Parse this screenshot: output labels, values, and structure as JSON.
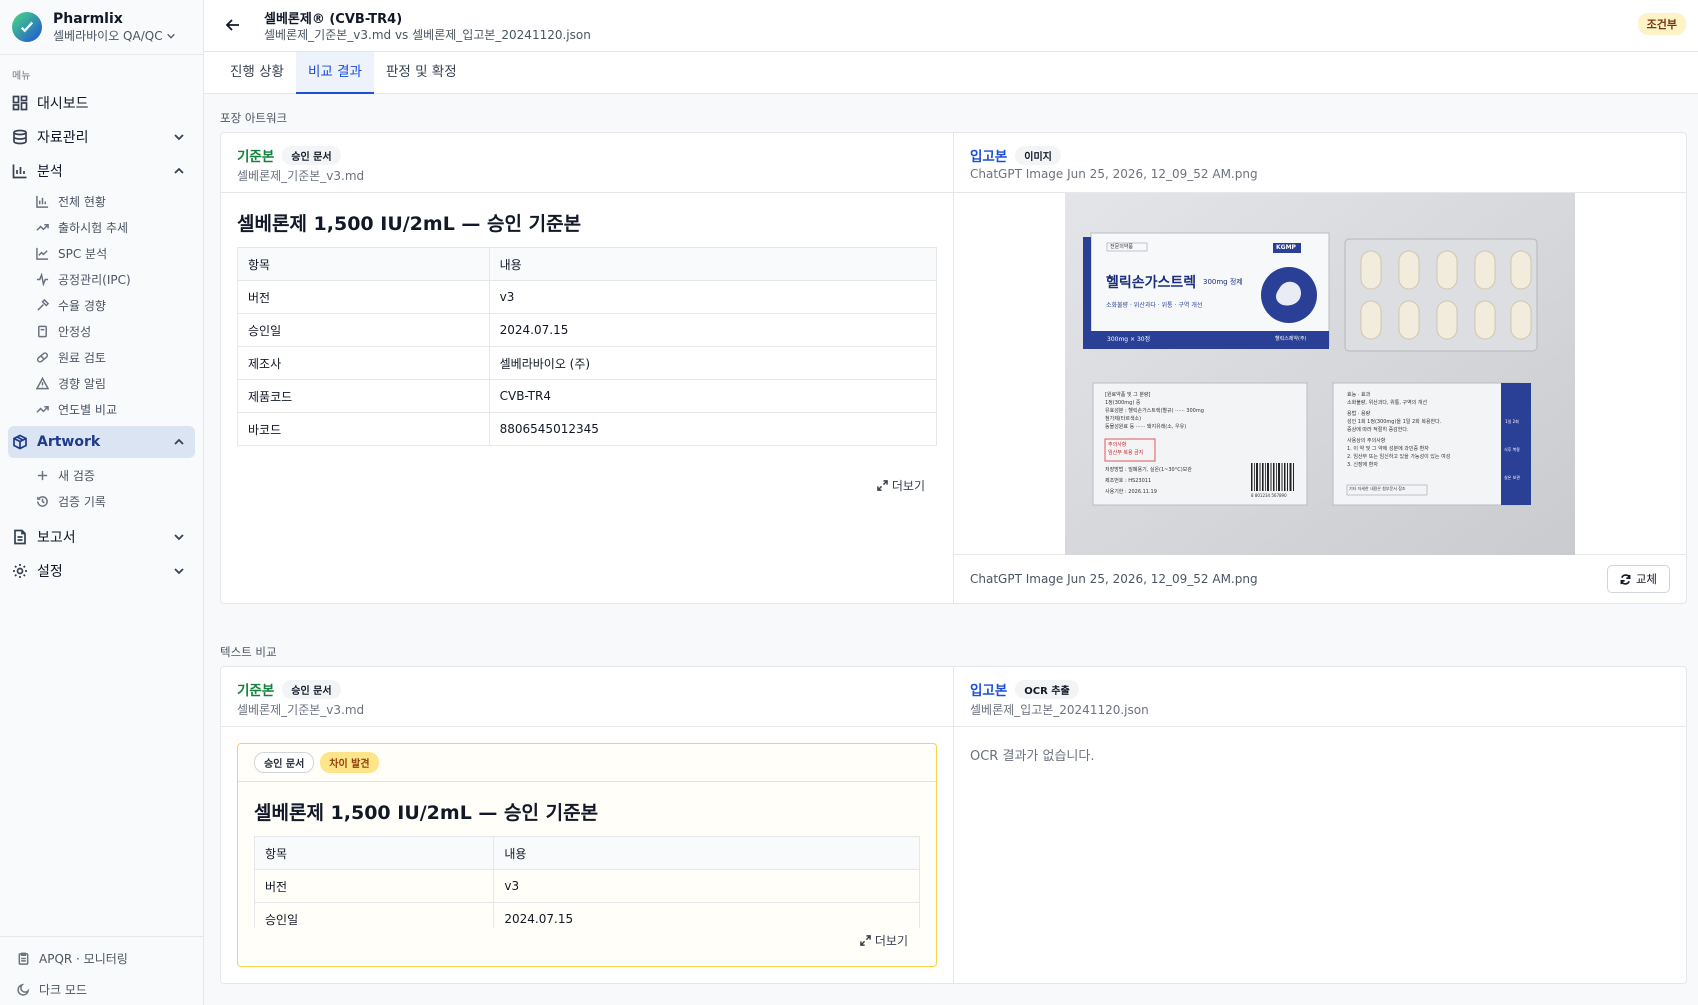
{
  "app": {
    "name": "Pharmlix",
    "org": "셀베라바이오 QA/QC"
  },
  "sidebar": {
    "menu_label": "메뉴",
    "items": [
      {
        "label": "대시보드"
      },
      {
        "label": "자료관리"
      },
      {
        "label": "분석"
      },
      {
        "label": "Artwork"
      },
      {
        "label": "보고서"
      },
      {
        "label": "설정"
      }
    ],
    "analysis_sub": [
      "전체 현황",
      "출하시험 추세",
      "SPC 분석",
      "공정관리(IPC)",
      "수율 경향",
      "안정성",
      "원료 검토",
      "경향 알림",
      "연도별 비교"
    ],
    "artwork_sub": [
      "새 검증",
      "검증 기록"
    ],
    "bottom": [
      "APQR · 모니터링",
      "다크 모드"
    ]
  },
  "header": {
    "title": "셀베론제® (CVB-TR4)",
    "subtitle": "셀베론제_기준본_v3.md vs 셀베론제_입고본_20241120.json",
    "badge": "조건부"
  },
  "tabs": [
    "진행 상황",
    "비교 결과",
    "판정 및 확정"
  ],
  "packaging": {
    "section_label": "포장 아트워크",
    "ref": {
      "label": "기준본",
      "chip": "승인 문서",
      "file": "셀베론제_기준본_v3.md",
      "heading": "셀베론제 1,500 IU/2mL — 승인 기준본",
      "table": [
        [
          "항목",
          "내용"
        ],
        [
          "버전",
          "v3"
        ],
        [
          "승인일",
          "2024.07.15"
        ],
        [
          "제조사",
          "셀베라바이오 (주)"
        ],
        [
          "제품코드",
          "CVB-TR4"
        ],
        [
          "바코드",
          "8806545012345"
        ]
      ],
      "more": "더보기"
    },
    "incoming": {
      "label": "입고본",
      "chip": "이미지",
      "file": "ChatGPT Image Jun 25, 2026, 12_09_52 AM.png",
      "footer_file": "ChatGPT Image Jun 25, 2026, 12_09_52 AM.png",
      "swap": "교체",
      "photo": {
        "top_tag": "전문의약품",
        "brand": "헬릭손가스트렉",
        "dose": "300mg 정제",
        "claims": "소화불량 · 위산과다 · 위통 · 구역 개선",
        "count": "300mg × 30정",
        "maker": "헬릭스제약(주)",
        "kgmp": "KGMP",
        "ingredients_title": "[원료약품 및 그 분량]",
        "ingredients_1": "1정(300mg) 중",
        "ingredients_2": "유효성분 : 헬릭손가스트렉(별규) ······ 300mg",
        "ingredients_3": "첨가제(타르색소)",
        "ingredients_4": "동물성원료 등 ······ 돼지유래(소, 우유)",
        "warning_1": "주의사항",
        "warning_2": "임산부 복용 금지",
        "storage": "저장방법 : 밀폐용기, 실온(1~30°C)보관",
        "lot_label": "제조번호 :",
        "lot": "HS23011",
        "exp_label": "사용기한 :",
        "exp": "2026.11.19",
        "barcode_num": "8 801234 567890",
        "effect_title": "효능 · 효과",
        "effect_text": "소화불량, 위산과다, 위통, 구역의 개선",
        "dosage_title": "용법 · 용량",
        "dosage_1": "성인 1회 1정(300mg)을 1일 2회 복용한다.",
        "dosage_2": "증상에 따라 적절히 증감한다.",
        "caution_title": "사용상의 주의사항",
        "caution_1": "1. 이 약 및 그 약에 성분에 과민증 환자",
        "caution_2": "2. 임산부 또는 임신하고 있을 가능성이 있는 여성",
        "caution_3": "3. 신장애 환자",
        "bottom_note": "기타 자세한 내용은 첨부문서 참조",
        "icon_1": "1일 2회",
        "icon_2": "식후 복용",
        "icon_3": "실온 보관"
      }
    }
  },
  "textcmp": {
    "section_label": "텍스트 비교",
    "ref": {
      "label": "기준본",
      "chip": "승인 문서",
      "file": "셀베론제_기준본_v3.md",
      "card_chip_1": "승인 문서",
      "card_chip_2": "차이 발견",
      "heading": "셀베론제 1,500 IU/2mL — 승인 기준본",
      "table": [
        [
          "항목",
          "내용"
        ],
        [
          "버전",
          "v3"
        ],
        [
          "승인일",
          "2024.07.15"
        ]
      ],
      "more": "더보기"
    },
    "incoming": {
      "label": "입고본",
      "chip": "OCR 추출",
      "file": "셀베론제_입고본_20241120.json",
      "empty": "OCR 결과가 없습니다."
    }
  },
  "colors": {
    "accent": "#1d4ed8",
    "ref_green": "#15803d",
    "diff_border": "#fcd34d",
    "badge_bg": "#fef3c7"
  }
}
